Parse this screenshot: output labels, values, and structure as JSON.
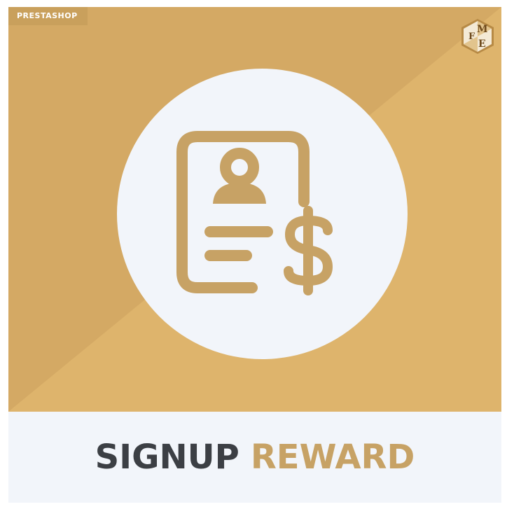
{
  "badge": {
    "text": "PRESTASHOP"
  },
  "logo": {
    "letters": [
      "F",
      "M",
      "E"
    ]
  },
  "title": {
    "word1": "SIGNUP",
    "word2": "REWARD"
  },
  "colors": {
    "banner_light": "#dfb56b",
    "banner_dark": "#d3a864",
    "icon": "#c7a265",
    "title_dark": "#3c3f44",
    "title_accent": "#c7a265",
    "panel": "#f2f5fa"
  }
}
